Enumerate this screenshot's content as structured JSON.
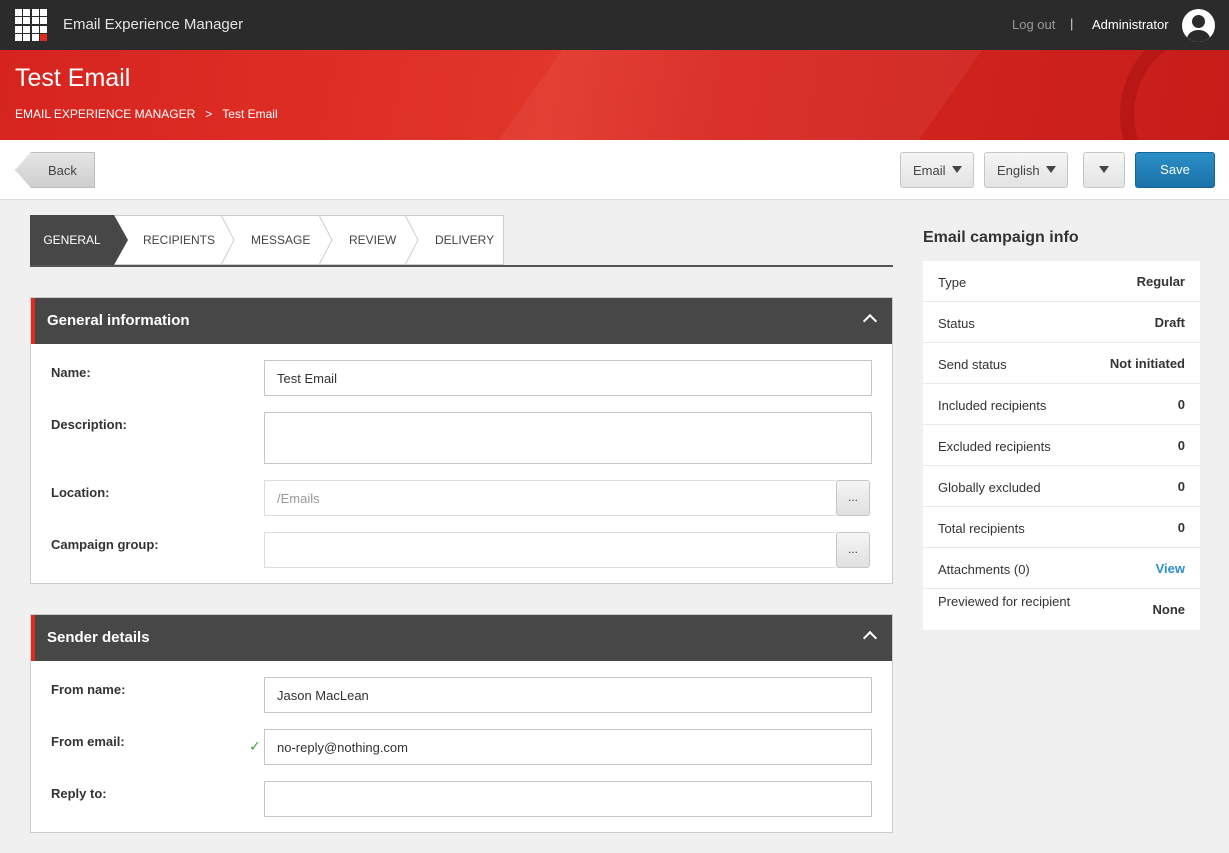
{
  "topbar": {
    "app_title": "Email Experience Manager",
    "logout": "Log out",
    "separator": "|",
    "user": "Administrator"
  },
  "hero": {
    "title": "Test Email",
    "breadcrumb": {
      "root": "EMAIL EXPERIENCE MANAGER",
      "sep": ">",
      "current": "Test Email"
    }
  },
  "toolbar": {
    "back": "Back",
    "type_dropdown": "Email",
    "language_dropdown": "English",
    "save": "Save"
  },
  "steps": [
    {
      "label": "GENERAL",
      "active": true
    },
    {
      "label": "RECIPIENTS",
      "active": false
    },
    {
      "label": "MESSAGE",
      "active": false
    },
    {
      "label": "REVIEW",
      "active": false
    },
    {
      "label": "DELIVERY",
      "active": false
    }
  ],
  "general": {
    "title": "General information",
    "name_label": "Name:",
    "name_value": "Test Email",
    "description_label": "Description:",
    "description_value": "",
    "location_label": "Location:",
    "location_value": "/Emails",
    "campaign_group_label": "Campaign group:",
    "campaign_group_value": "",
    "browse": "..."
  },
  "sender": {
    "title": "Sender details",
    "from_name_label": "From name:",
    "from_name_value": "Jason MacLean",
    "from_email_label": "From email:",
    "from_email_value": "no-reply@nothing.com",
    "valid_mark": "✓",
    "reply_to_label": "Reply to:",
    "reply_to_value": ""
  },
  "campaign_info": {
    "title": "Email campaign info",
    "rows": [
      {
        "key": "Type",
        "value": "Regular"
      },
      {
        "key": "Status",
        "value": "Draft"
      },
      {
        "key": "Send status",
        "value": "Not initiated"
      },
      {
        "key": "Included recipients",
        "value": "0"
      },
      {
        "key": "Excluded recipients",
        "value": "0"
      },
      {
        "key": "Globally excluded",
        "value": "0"
      },
      {
        "key": "Total recipients",
        "value": "0"
      },
      {
        "key": "Attachments (0)",
        "value": "View"
      },
      {
        "key": "Previewed for recipient",
        "value": "None"
      }
    ]
  },
  "colors": {
    "accent_red": "#e02b20",
    "save_blue": "#1a72a8",
    "dark": "#474747"
  }
}
